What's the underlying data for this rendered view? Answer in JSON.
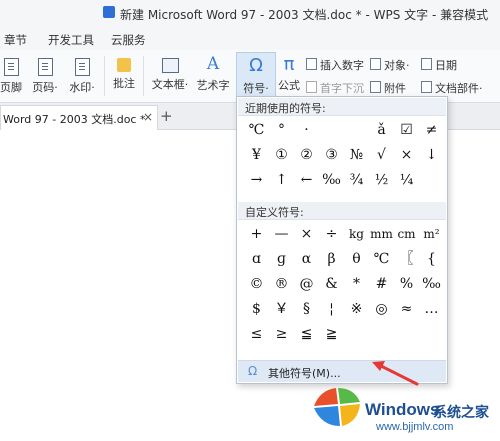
{
  "title_bar": {
    "title": "新建 Microsoft Word 97 - 2003 文档.doc * - WPS 文字 - 兼容模式"
  },
  "menu": [
    "章节",
    "开发工具",
    "云服务"
  ],
  "ribbon": {
    "page_corner": "页脚",
    "page_number": "页码·",
    "watermark": "水印·",
    "comment": "批注",
    "textbox": "文本框·",
    "wordart": "艺术字",
    "symbol": "符号·",
    "formula": "公式",
    "insert_number": "插入数字",
    "object": "对象·",
    "date": "日期",
    "drop_cap": "首字下沉",
    "attachment": "附件",
    "doc_parts": "文档部件·"
  },
  "doc_tab": {
    "label": "Word 97 - 2003 文档.doc *",
    "close": "×",
    "new": "+"
  },
  "symbol_menu": {
    "recent_header": "近期使用的符号:",
    "recent": [
      [
        "℃",
        "°",
        "·",
        "",
        "",
        "ǎ",
        "☑",
        "≠"
      ],
      [
        "¥",
        "①",
        "②",
        "③",
        "№",
        "√",
        "×",
        "↓"
      ],
      [
        "→",
        "↑",
        "←",
        "‰",
        "¾",
        "½",
        "¼",
        ""
      ]
    ],
    "custom_header": "自定义符号:",
    "custom": [
      [
        "+",
        "—",
        "×",
        "÷",
        "kg",
        "mm",
        "cm",
        "m²"
      ],
      [
        "ɑ",
        "ɡ",
        "α",
        "β",
        "θ",
        "℃",
        "〖",
        "{"
      ],
      [
        "©",
        "®",
        "@",
        "&",
        "*",
        "#",
        "%",
        "‰"
      ],
      [
        "$",
        "￥",
        "§",
        "¦",
        "※",
        "◎",
        "≈",
        "…"
      ],
      [
        "≤",
        "≥",
        "≦",
        "≧",
        "",
        "",
        "",
        ""
      ]
    ],
    "more": "其他符号(M)...",
    "more_icon": "Ω"
  },
  "watermark": {
    "brand": "Windows",
    "brand_cn": "系统之家",
    "url": "www.bjjmlv.com"
  },
  "colors": {
    "accent": "#2e6fd6",
    "arrow": "#e53935",
    "selected": "#dbe8f7"
  }
}
